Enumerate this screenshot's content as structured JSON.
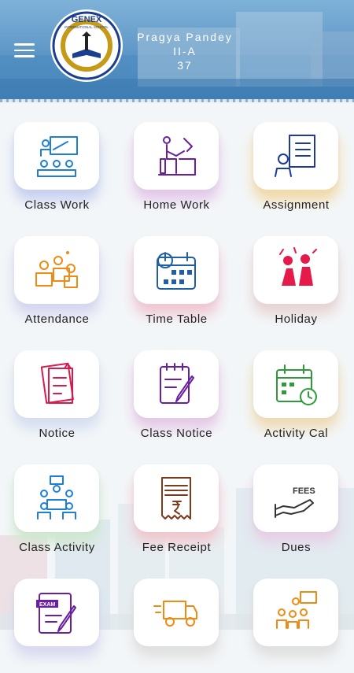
{
  "header": {
    "school_name": "GENEX",
    "school_subtitle": "INTERNATIONAL SCHOOL",
    "student_name": "Pragya Pandey",
    "class_section": "II-A",
    "roll_number": "37"
  },
  "tiles": [
    {
      "label": "Class Work",
      "icon": "class-work-icon",
      "color": "#1f7fd6",
      "shadow": "#c7d0f0"
    },
    {
      "label": "Home Work",
      "icon": "home-work-icon",
      "color": "#6a1fa0",
      "shadow": "#e4c8ea"
    },
    {
      "label": "Assignment",
      "icon": "assignment-icon",
      "color": "#1e3a9e",
      "shadow": "#f2d9a6"
    },
    {
      "label": "Attendance",
      "icon": "attendance-icon",
      "color": "#f08a12",
      "shadow": "#d5d6f1"
    },
    {
      "label": "Time Table",
      "icon": "time-table-icon",
      "color": "#1e5fa8",
      "shadow": "#f0c6d2"
    },
    {
      "label": "Holiday",
      "icon": "holiday-icon",
      "color": "#e6194b",
      "shadow": "#e8d4d4"
    },
    {
      "label": "Notice",
      "icon": "notice-icon",
      "color": "#d81b4a",
      "shadow": "#d6dff0"
    },
    {
      "label": "Class Notice",
      "icon": "class-notice-icon",
      "color": "#6a1fa0",
      "shadow": "#e5c9e5"
    },
    {
      "label": "Activity Cal",
      "icon": "activity-calendar-icon",
      "color": "#2e9a3a",
      "shadow": "#eedbb4"
    },
    {
      "label": "Class Activity",
      "icon": "class-activity-icon",
      "color": "#1f7fd6",
      "shadow": "#cfe8cf"
    },
    {
      "label": "Fee Receipt",
      "icon": "fee-receipt-icon",
      "color": "#7a3b1e",
      "shadow": "#f0c8cf"
    },
    {
      "label": "Dues",
      "icon": "fees-dues-icon",
      "color": "#333333",
      "shadow": "#e6d0e6"
    },
    {
      "label": "",
      "icon": "exam-icon",
      "color": "#6a1fa0",
      "shadow": "#d9d9f0"
    },
    {
      "label": "",
      "icon": "transport-icon",
      "color": "#f08a12",
      "shadow": "#e0e0e0"
    },
    {
      "label": "",
      "icon": "meeting-icon",
      "color": "#f08a12",
      "shadow": "#e0e0e0"
    }
  ]
}
